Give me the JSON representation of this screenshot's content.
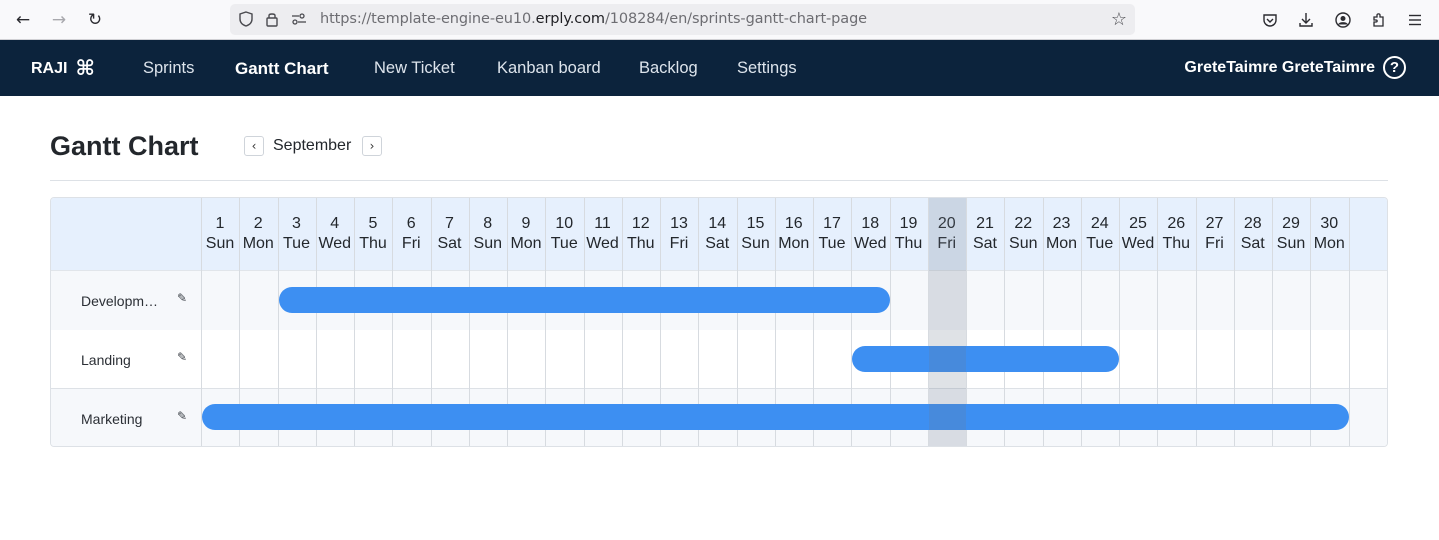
{
  "browser": {
    "url_prefix": "https://template-engine-eu10.",
    "url_domain": "erply.com",
    "url_path": "/108284/en/sprints-gantt-chart-page",
    "icons": {
      "back": "←",
      "forward": "→",
      "reload": "↻",
      "shield": "⛉",
      "lock": "🔒",
      "permissions": "⚌",
      "bookmark_star": "☆",
      "pocket": "⛉",
      "downloads": "⤓",
      "account": "◉",
      "extensions": "⧉",
      "menu": "≡"
    }
  },
  "appnav": {
    "logo_text": "RAJI",
    "logo_icon": "⌘",
    "items": [
      {
        "label": "Sprints",
        "active": false
      },
      {
        "label": "Gantt Chart",
        "active": true
      },
      {
        "label": "New Ticket",
        "active": false
      },
      {
        "label": "Kanban board",
        "active": false
      },
      {
        "label": "Backlog",
        "active": false
      },
      {
        "label": "Settings",
        "active": false
      }
    ],
    "user_name": "GreteTaimre GreteTaimre",
    "help_icon": "?"
  },
  "page": {
    "title": "Gantt Chart",
    "month": "September",
    "prev_icon": "‹",
    "next_icon": "›"
  },
  "gantt": {
    "today_day": 20,
    "edit_icon": "✎",
    "days": [
      {
        "num": "1",
        "dow": "Sun"
      },
      {
        "num": "2",
        "dow": "Mon"
      },
      {
        "num": "3",
        "dow": "Tue"
      },
      {
        "num": "4",
        "dow": "Wed"
      },
      {
        "num": "5",
        "dow": "Thu"
      },
      {
        "num": "6",
        "dow": "Fri"
      },
      {
        "num": "7",
        "dow": "Sat"
      },
      {
        "num": "8",
        "dow": "Sun"
      },
      {
        "num": "9",
        "dow": "Mon"
      },
      {
        "num": "10",
        "dow": "Tue"
      },
      {
        "num": "11",
        "dow": "Wed"
      },
      {
        "num": "12",
        "dow": "Thu"
      },
      {
        "num": "13",
        "dow": "Fri"
      },
      {
        "num": "14",
        "dow": "Sat"
      },
      {
        "num": "15",
        "dow": "Sun"
      },
      {
        "num": "16",
        "dow": "Mon"
      },
      {
        "num": "17",
        "dow": "Tue"
      },
      {
        "num": "18",
        "dow": "Wed"
      },
      {
        "num": "19",
        "dow": "Thu"
      },
      {
        "num": "20",
        "dow": "Fri"
      },
      {
        "num": "21",
        "dow": "Sat"
      },
      {
        "num": "22",
        "dow": "Sun"
      },
      {
        "num": "23",
        "dow": "Mon"
      },
      {
        "num": "24",
        "dow": "Tue"
      },
      {
        "num": "25",
        "dow": "Wed"
      },
      {
        "num": "26",
        "dow": "Thu"
      },
      {
        "num": "27",
        "dow": "Fri"
      },
      {
        "num": "28",
        "dow": "Sat"
      },
      {
        "num": "29",
        "dow": "Sun"
      },
      {
        "num": "30",
        "dow": "Mon"
      }
    ],
    "rows": [
      {
        "label": "Developme...",
        "full_label": "Development",
        "start_day": 3,
        "end_day": 18
      },
      {
        "label": "Landing",
        "full_label": "Landing",
        "start_day": 18,
        "end_day": 24
      },
      {
        "label": "Marketing",
        "full_label": "Marketing",
        "start_day": 1,
        "end_day": 30
      }
    ],
    "bar_color": "#3d8ff2"
  },
  "chart_data": {
    "type": "gantt",
    "title": "Gantt Chart",
    "month": "September",
    "x_unit": "day",
    "xlim": [
      1,
      30
    ],
    "today": 20,
    "tasks": [
      {
        "name": "Development",
        "start": 3,
        "end": 18
      },
      {
        "name": "Landing",
        "start": 18,
        "end": 24
      },
      {
        "name": "Marketing",
        "start": 1,
        "end": 30
      }
    ]
  }
}
